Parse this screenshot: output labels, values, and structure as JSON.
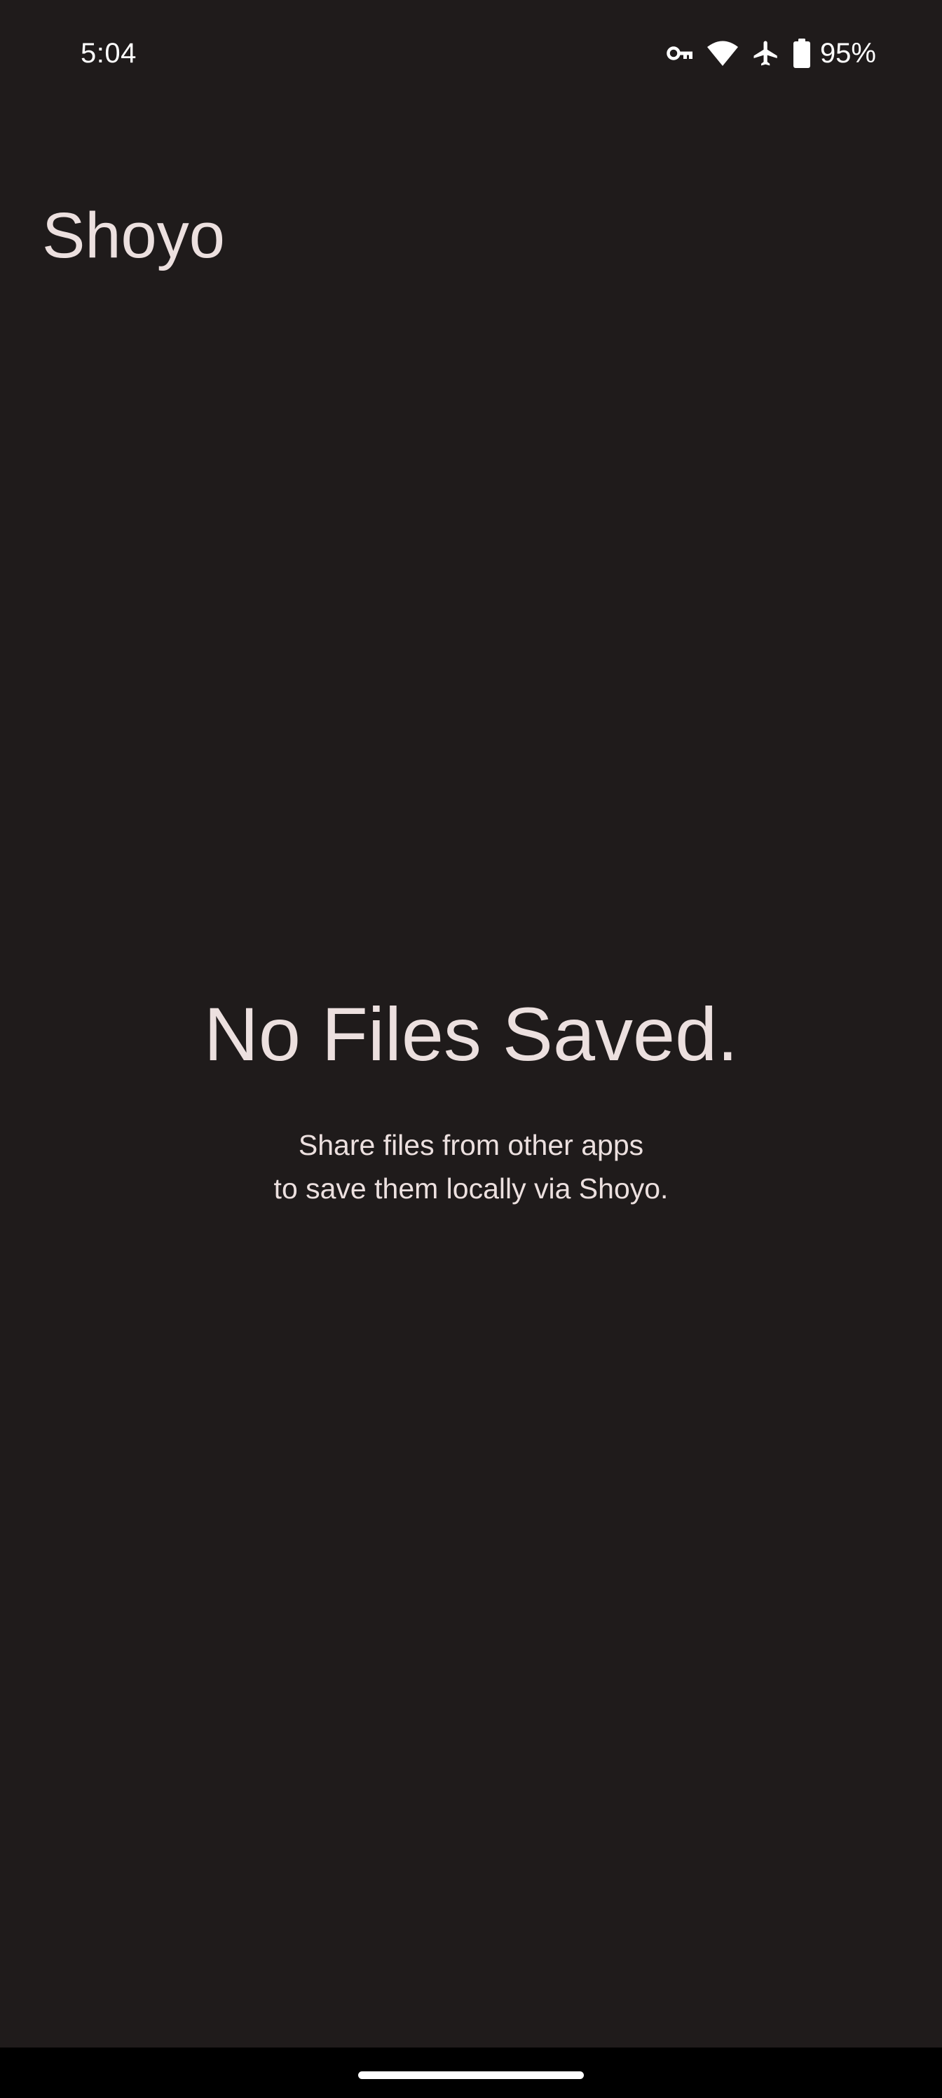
{
  "status_bar": {
    "time": "5:04",
    "battery_percent": "95%",
    "icons": [
      "vpn-key-icon",
      "wifi-icon",
      "airplane-mode-icon",
      "battery-icon"
    ]
  },
  "app": {
    "title": "Shoyo"
  },
  "empty_state": {
    "heading": "No Files Saved.",
    "line1": "Share files from other apps",
    "line2": "to save them locally via Shoyo."
  },
  "theme": {
    "background": "#1f1b1b",
    "text": "#ece0df",
    "nav_bar": "#000000"
  }
}
